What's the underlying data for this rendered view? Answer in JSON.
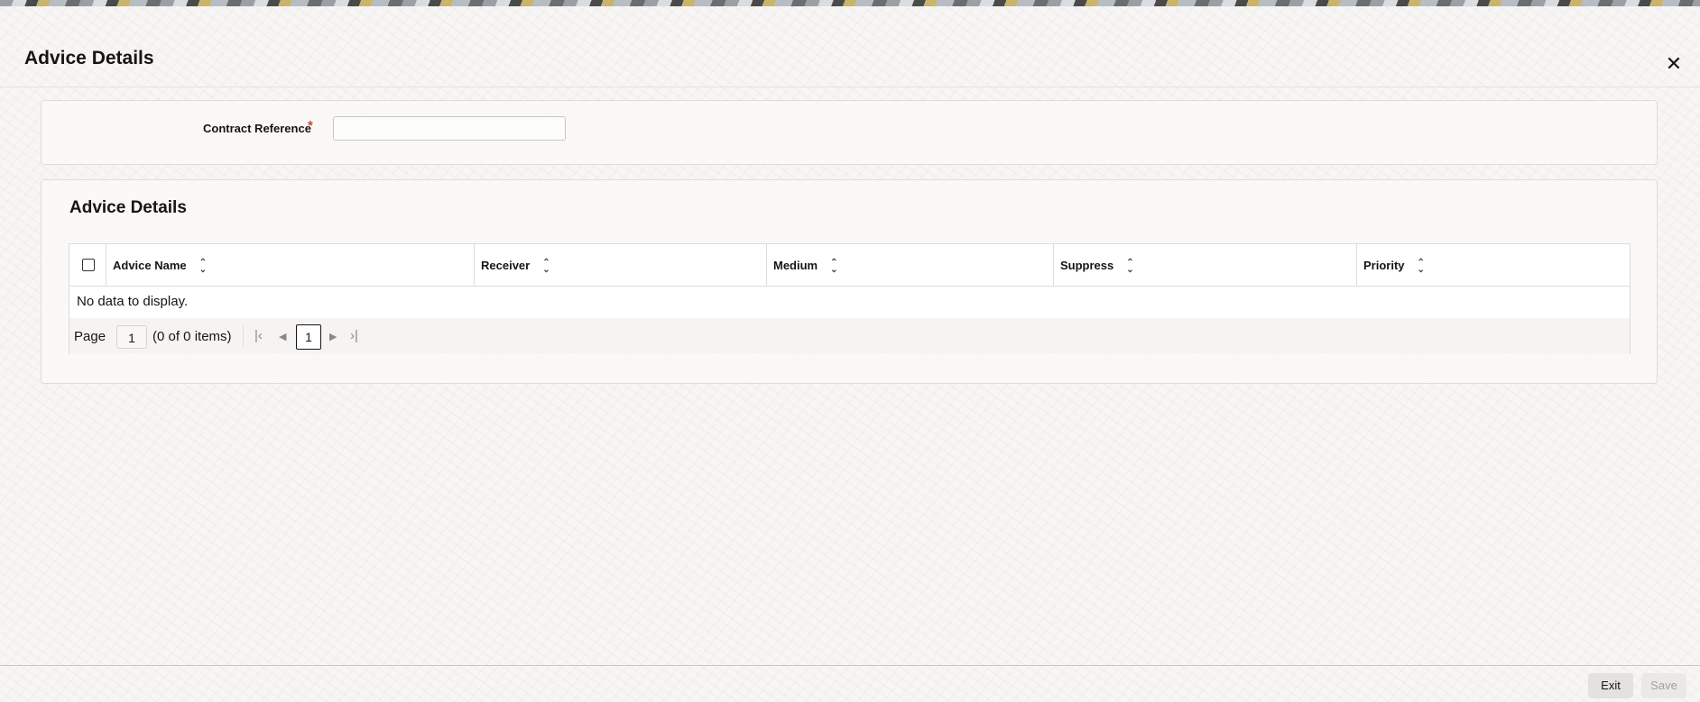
{
  "window": {
    "title": "Advice Details",
    "close_icon": "close-icon"
  },
  "form": {
    "contract_reference_label": "Contract Reference",
    "required_marker": "*",
    "contract_reference_value": ""
  },
  "advice_section": {
    "title": "Advice Details",
    "columns": [
      "Advice Name",
      "Receiver",
      "Medium",
      "Suppress",
      "Priority"
    ],
    "empty_text": "No data to display.",
    "pager": {
      "page_label": "Page",
      "page_value": "1",
      "item_count": "(0 of 0 items)",
      "current_page": "1"
    }
  },
  "footer": {
    "exit_label": "Exit",
    "save_label": "Save"
  }
}
